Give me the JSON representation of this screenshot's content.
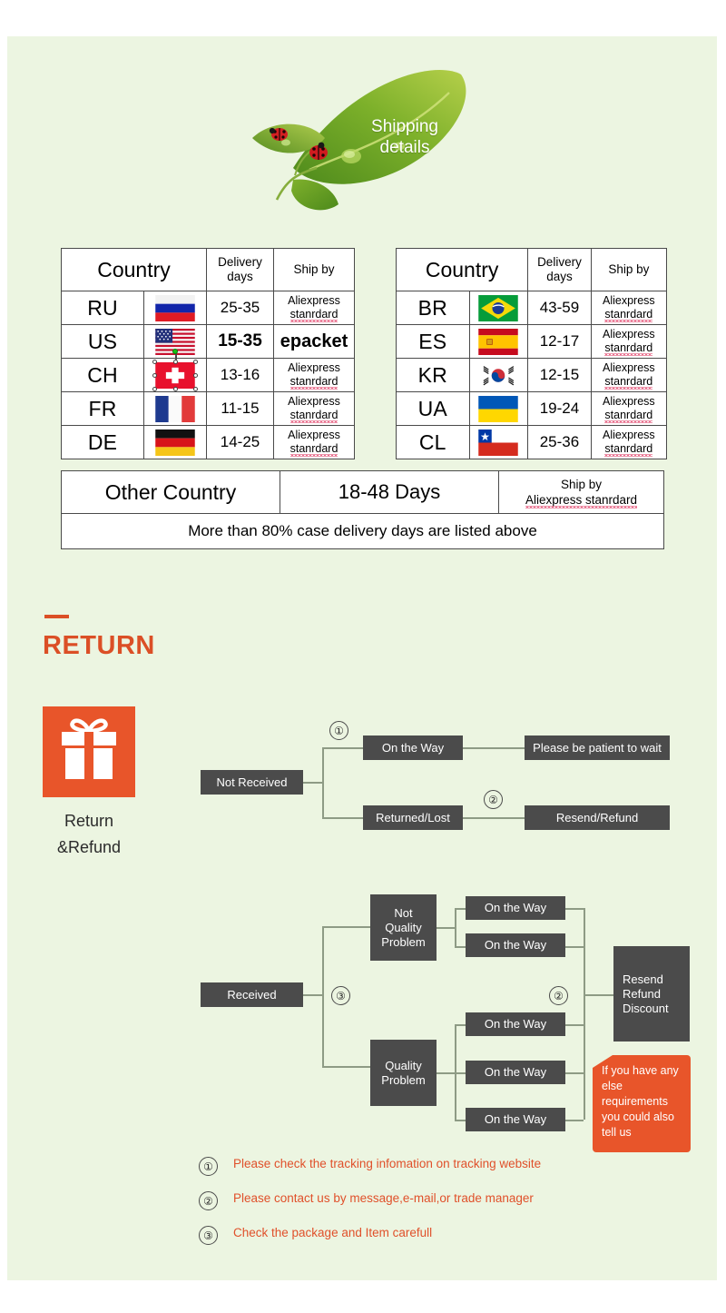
{
  "banner": {
    "title_line1": "Shipping",
    "title_line2": "details",
    "icon": "leaf-with-ladybugs"
  },
  "tables": {
    "headers": {
      "country": "Country",
      "delivery_days": "Delivery days",
      "ship_by": "Ship by"
    },
    "left": [
      {
        "code": "RU",
        "flag": "flag-russia",
        "days": "25-35",
        "ship": "Aliexpress stanrdard",
        "emphasis": false
      },
      {
        "code": "US",
        "flag": "flag-usa",
        "days": "15-35",
        "ship": "epacket",
        "emphasis": true
      },
      {
        "code": "CH",
        "flag": "flag-switzerland",
        "days": "13-16",
        "ship": "Aliexpress stanrdard",
        "emphasis": false
      },
      {
        "code": "FR",
        "flag": "flag-france",
        "days": "11-15",
        "ship": "Aliexpress stanrdard",
        "emphasis": false
      },
      {
        "code": "DE",
        "flag": "flag-germany",
        "days": "14-25",
        "ship": "Aliexpress stanrdard",
        "emphasis": false
      }
    ],
    "right": [
      {
        "code": "BR",
        "flag": "flag-brazil",
        "days": "43-59",
        "ship": "Aliexpress stanrdard"
      },
      {
        "code": "ES",
        "flag": "flag-spain",
        "days": "12-17",
        "ship": "Aliexpress stanrdard"
      },
      {
        "code": "KR",
        "flag": "flag-south-korea",
        "days": "12-15",
        "ship": "Aliexpress stanrdard"
      },
      {
        "code": "UA",
        "flag": "flag-ukraine",
        "days": "19-24",
        "ship": "Aliexpress stanrdard"
      },
      {
        "code": "CL",
        "flag": "flag-chile",
        "days": "25-36",
        "ship": "Aliexpress stanrdard"
      }
    ],
    "other_row": {
      "country": "Other Country",
      "days": "18-48 Days",
      "ship_line1": "Ship by",
      "ship_line2": "Aliexpress stanrdard"
    },
    "note": "More than 80% case delivery days are listed above"
  },
  "return_section": {
    "title": "RETURN",
    "gift_icon": "gift-box-icon",
    "gift_label_line1": "Return",
    "gift_label_line2": "&Refund"
  },
  "flow_top": {
    "root": "Not Received",
    "branch_a": "On the Way",
    "branch_a_result": "Please be patient to wait",
    "branch_a_marker": "①",
    "branch_b": "Returned/Lost",
    "branch_b_result": "Resend/Refund",
    "branch_b_marker": "②"
  },
  "flow_bottom": {
    "root": "Received",
    "root_marker": "③",
    "not_quality": "Not\nQuality\nProblem",
    "not_quality_l1": "Not",
    "not_quality_l2": "Quality",
    "not_quality_l3": "Problem",
    "quality_l1": "Quality",
    "quality_l2": "Problem",
    "step_nq_1": "On the Way",
    "step_nq_2": "On the Way",
    "step_q_1": "On the Way",
    "step_q_2": "On the Way",
    "step_q_3": "On the Way",
    "result_marker": "②",
    "result_l1": "Resend",
    "result_l2": "Refund",
    "result_l3": "Discount",
    "callout": "If you have any else requirements you could also tell us"
  },
  "footnotes": [
    {
      "marker": "①",
      "text": "Please check the tracking infomation on tracking website"
    },
    {
      "marker": "②",
      "text": "Please contact us by message,e-mail,or trade manager"
    },
    {
      "marker": "③",
      "text": "Check the package and Item carefull"
    }
  ],
  "colors": {
    "background": "#ecf5e1",
    "accent_orange": "#db4f26",
    "box_gray": "#4b4b4b",
    "note_green": "#4f7a15",
    "line_gray": "#8e9b85"
  }
}
